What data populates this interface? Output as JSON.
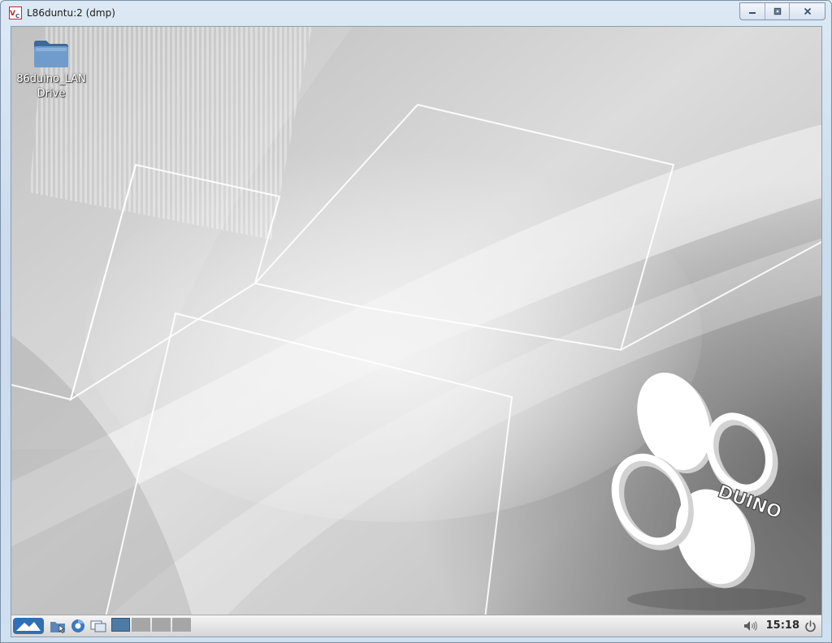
{
  "window": {
    "title": "L86duntu:2 (dmp)",
    "app_icon": "vnc-viewer-icon",
    "controls": [
      "minimize-icon",
      "restore-icon",
      "close-icon"
    ]
  },
  "desktop": {
    "icons": [
      {
        "label": "86duino_LAN Drive",
        "icon": "folder-icon"
      }
    ],
    "logo_text": "DUINO"
  },
  "taskbar": {
    "launchers": [
      "start-menu-icon",
      "file-manager-icon",
      "web-browser-icon",
      "show-desktop-icon"
    ],
    "workspaces": 4,
    "active_workspace": 1,
    "tray": [
      "volume-icon"
    ],
    "clock": "15:18",
    "power_icon": "power-icon"
  },
  "colors": {
    "active_workspace": "#4d7ba3",
    "taskbar_launcher_blue": "#2f6fb5",
    "title_app_icon_red": "#c0282d"
  }
}
